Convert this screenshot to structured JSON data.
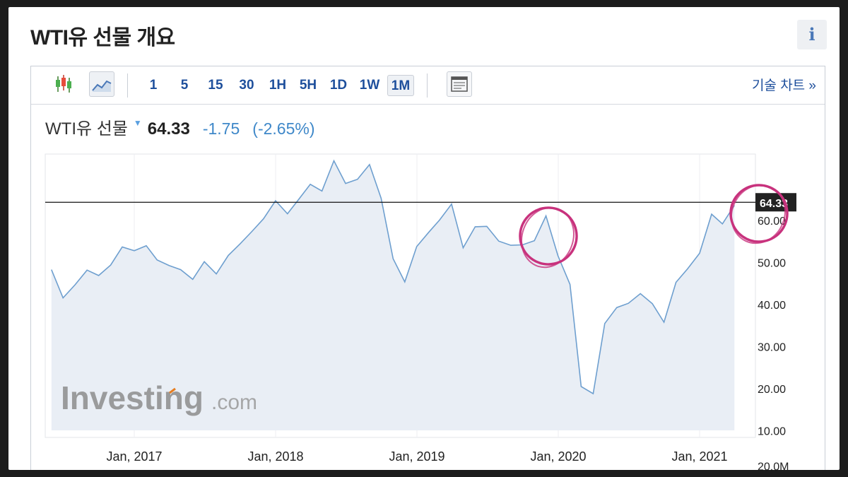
{
  "page": {
    "title": "WTI유 선물 개요",
    "info_label": "i"
  },
  "toolbar": {
    "timeframes": [
      "1",
      "5",
      "15",
      "30",
      "1H",
      "5H",
      "1D",
      "1W",
      "1M"
    ],
    "selected_timeframe": "1M",
    "tech_chart_link": "기술 차트 »"
  },
  "quote": {
    "name": "WTI유 선물",
    "price": "64.33",
    "change": "-1.75",
    "change_pct": "(-2.65%)"
  },
  "watermark": {
    "brand": "Investing",
    "suffix": ".com"
  },
  "colors": {
    "line": "#6e9fcf",
    "area": "#e9eef5",
    "link": "#1e4f9c",
    "change": "#3f88c9",
    "annotation": "#c8327d"
  },
  "chart_data": {
    "type": "area",
    "x_ticks": [
      "Jan, 2017",
      "Jan, 2018",
      "Jan, 2019",
      "Jan, 2020",
      "Jan, 2021"
    ],
    "y_ticks": [
      "60.00",
      "50.00",
      "40.00",
      "30.00",
      "20.00",
      "10.00",
      "20.0M"
    ],
    "ylim": [
      10,
      73
    ],
    "current_price_label": "64.33",
    "current_price": 64.33,
    "series": [
      {
        "dates": [
          "2016-06",
          "2016-07",
          "2016-08",
          "2016-09",
          "2016-10",
          "2016-11",
          "2016-12",
          "2017-01",
          "2017-02",
          "2017-03",
          "2017-04",
          "2017-05",
          "2017-06",
          "2017-07",
          "2017-08",
          "2017-09",
          "2017-10",
          "2017-11",
          "2017-12",
          "2018-01",
          "2018-02",
          "2018-03",
          "2018-04",
          "2018-05",
          "2018-06",
          "2018-07",
          "2018-08",
          "2018-09",
          "2018-10",
          "2018-11",
          "2018-12",
          "2019-01",
          "2019-02",
          "2019-03",
          "2019-04",
          "2019-05",
          "2019-06",
          "2019-07",
          "2019-08",
          "2019-09",
          "2019-10",
          "2019-11",
          "2019-12",
          "2020-01",
          "2020-02",
          "2020-03",
          "2020-04",
          "2020-05",
          "2020-06",
          "2020-07",
          "2020-08",
          "2020-09",
          "2020-10",
          "2020-11",
          "2020-12",
          "2021-01",
          "2021-02",
          "2021-03",
          "2021-04"
        ],
        "values": [
          48.3,
          41.6,
          44.7,
          48.2,
          46.9,
          49.4,
          53.7,
          52.8,
          54.0,
          50.6,
          49.3,
          48.3,
          46.0,
          50.2,
          47.3,
          51.7,
          54.4,
          57.4,
          60.4,
          64.7,
          61.6,
          64.9,
          68.6,
          67.0,
          74.2,
          68.8,
          69.8,
          73.3,
          65.3,
          50.9,
          45.4,
          53.8,
          57.2,
          60.1,
          63.9,
          53.5,
          58.5,
          58.6,
          55.1,
          54.1,
          54.2,
          55.2,
          61.1,
          51.6,
          44.8,
          20.5,
          18.8,
          35.5,
          39.3,
          40.3,
          42.6,
          40.2,
          35.8,
          45.3,
          48.5,
          52.2,
          61.5,
          59.2,
          63.6
        ]
      }
    ],
    "annotations": [
      "circle near 2019-12 peak",
      "circle near current price"
    ]
  }
}
